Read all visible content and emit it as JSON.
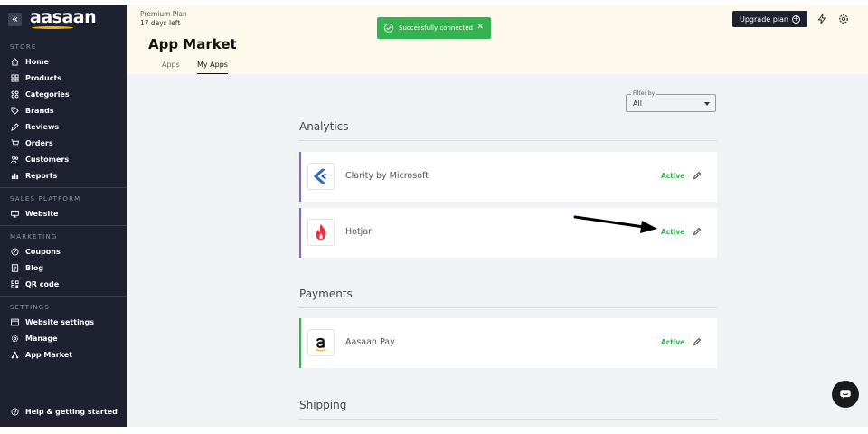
{
  "sidebar": {
    "logo": "aasaan",
    "collapse_icon": "«",
    "sections": [
      {
        "label": "STORE",
        "items": [
          "Home",
          "Products",
          "Categories",
          "Brands",
          "Reviews",
          "Orders",
          "Customers",
          "Reports"
        ]
      },
      {
        "label": "SALES PLATFORM",
        "items": [
          "Website"
        ]
      },
      {
        "label": "MARKETING",
        "items": [
          "Coupons",
          "Blog",
          "QR code"
        ]
      },
      {
        "label": "SETTINGS",
        "items": [
          "Website settings",
          "Manage",
          "App Market"
        ]
      }
    ],
    "help": "Help & getting started"
  },
  "header": {
    "plan_name": "Premium Plan",
    "plan_days": "17 days left",
    "title": "App Market",
    "tabs": [
      "Apps",
      "My Apps"
    ],
    "active_tab": "My Apps",
    "upgrade_label": "Upgrade plan",
    "upgrade_icon": "+"
  },
  "toast": {
    "message": "Successfully connected",
    "close": "✕",
    "color": "#34b24f"
  },
  "filter": {
    "label": "Filter by",
    "value": "All"
  },
  "sections": [
    {
      "title": "Analytics",
      "apps": [
        {
          "name": "Clarity by Microsoft",
          "status": "Active",
          "accent": "#7b6bd1"
        },
        {
          "name": "Hotjar",
          "status": "Active",
          "accent": "#7b6bd1"
        }
      ]
    },
    {
      "title": "Payments",
      "apps": [
        {
          "name": "Aasaan Pay",
          "status": "Active",
          "accent": "#34b24f"
        }
      ]
    },
    {
      "title": "Shipping",
      "apps": []
    }
  ],
  "colors": {
    "sidebar_bg": "#1e2130",
    "header_bg": "#fdf9ec",
    "main_bg": "#f0f3f6",
    "active_green": "#34b24f"
  }
}
